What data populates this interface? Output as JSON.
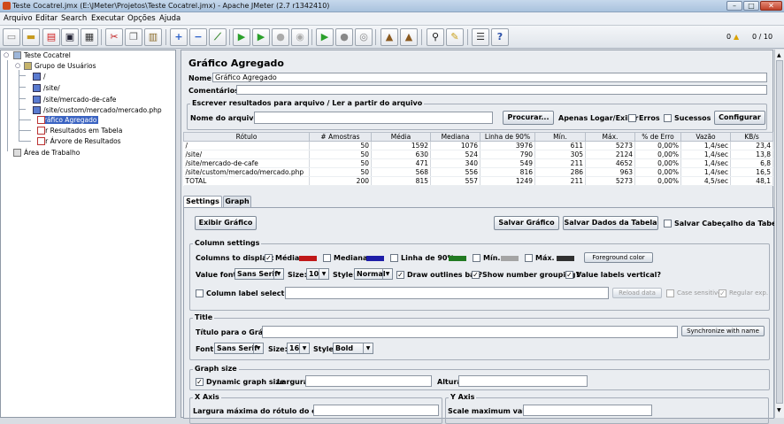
{
  "window": {
    "title": "Teste Cocatrel.jmx (E:\\JMeter\\Projetos\\Teste Cocatrel.jmx) - Apache JMeter (2.7 r1342410)"
  },
  "menu": [
    "Arquivo",
    "Editar",
    "Search",
    "Executar",
    "Opções",
    "Ajuda"
  ],
  "toolbar_status": {
    "warnings": "0",
    "threads": "0 / 10"
  },
  "tree": {
    "plan": "Teste Cocatrel",
    "group": "Grupo de Usuários",
    "samplers": [
      "/",
      "/site/",
      "/site/mercado-de-cafe",
      "/site/custom/mercado/mercado.php"
    ],
    "listeners": [
      "Gráfico Agregado",
      "Ver Resultados em Tabela",
      "Ver Árvore de Resultados"
    ],
    "workbench": "Área de Trabalho"
  },
  "panel": {
    "title": "Gráfico Agregado",
    "name_label": "Nome:",
    "name_value": "Gráfico Agregado",
    "comments_label": "Comentários:",
    "file_group": "Escrever resultados para arquivo / Ler a partir do arquivo",
    "filename_label": "Nome do arquivo",
    "browse": "Procurar...",
    "log_only": "Apenas Logar/Exibir",
    "errors": "Erros",
    "successes": "Sucessos",
    "configure": "Configurar"
  },
  "table": {
    "headers": [
      "Rótulo",
      "# Amostras",
      "Média",
      "Mediana",
      "Linha de 90%",
      "Mín.",
      "Máx.",
      "% de Erro",
      "Vazão",
      "KB/s"
    ],
    "rows": [
      [
        "/",
        "50",
        "1592",
        "1076",
        "3976",
        "611",
        "5273",
        "0,00%",
        "1,4/sec",
        "23,4"
      ],
      [
        "/site/",
        "50",
        "630",
        "524",
        "790",
        "305",
        "2124",
        "0,00%",
        "1,4/sec",
        "13,8"
      ],
      [
        "/site/mercado-de-cafe",
        "50",
        "471",
        "340",
        "549",
        "211",
        "4652",
        "0,00%",
        "1,4/sec",
        "6,8"
      ],
      [
        "/site/custom/mercado/mercado.php",
        "50",
        "568",
        "556",
        "816",
        "286",
        "963",
        "0,00%",
        "1,4/sec",
        "16,5"
      ],
      [
        "TOTAL",
        "200",
        "815",
        "557",
        "1249",
        "211",
        "5273",
        "0,00%",
        "4,5/sec",
        "48,1"
      ]
    ]
  },
  "tabs": [
    "Settings",
    "Graph"
  ],
  "settings": {
    "display_graph": "Exibir Gráfico",
    "save_graph": "Salvar Gráfico",
    "save_table": "Salvar Dados da Tabela",
    "save_header": "Salvar Cabeçalho da Tabela",
    "column_settings": "Column settings",
    "columns_to_display": "Columns to display:",
    "columns": [
      {
        "label": "Média",
        "checked": true,
        "color": "#c01818"
      },
      {
        "label": "Mediana",
        "checked": false,
        "color": "#1e1ea8"
      },
      {
        "label": "Linha de 90%",
        "checked": false,
        "color": "#227a22"
      },
      {
        "label": "Mín.",
        "checked": false,
        "color": "#a4a4a4"
      },
      {
        "label": "Máx.",
        "checked": false,
        "color": "#303030"
      }
    ],
    "foreground_color": "Foreground color",
    "value_font_label": "Value font:",
    "value_font": "Sans Serif",
    "size_label": "Size:",
    "value_size": "10",
    "style_label": "Style:",
    "value_style": "Normal",
    "draw_outlines": "Draw outlines bar?",
    "number_grouping": "Show number grouping?",
    "labels_vertical": "Value labels vertical?",
    "column_label_selection": "Column label selection:",
    "reload_data": "Reload data",
    "case_sensitive": "Case sensitive",
    "regular_exp": "Regular exp.",
    "title_group": "Title",
    "graph_title_label": "Título para o Gráfico",
    "synchronize": "Synchronize with name",
    "font_label": "Font:",
    "title_font": "Sans Serif",
    "title_size": "16",
    "title_style": "Bold",
    "graph_size_group": "Graph size",
    "dynamic_size": "Dynamic graph size",
    "width_label": "Largura",
    "height_label": "Altura",
    "x_axis_group": "X Axis",
    "y_axis_group": "Y Axis",
    "x_max_label": "Largura máxima do rótulo do eixo x",
    "y_scale_label": "Scale maximum value:"
  }
}
